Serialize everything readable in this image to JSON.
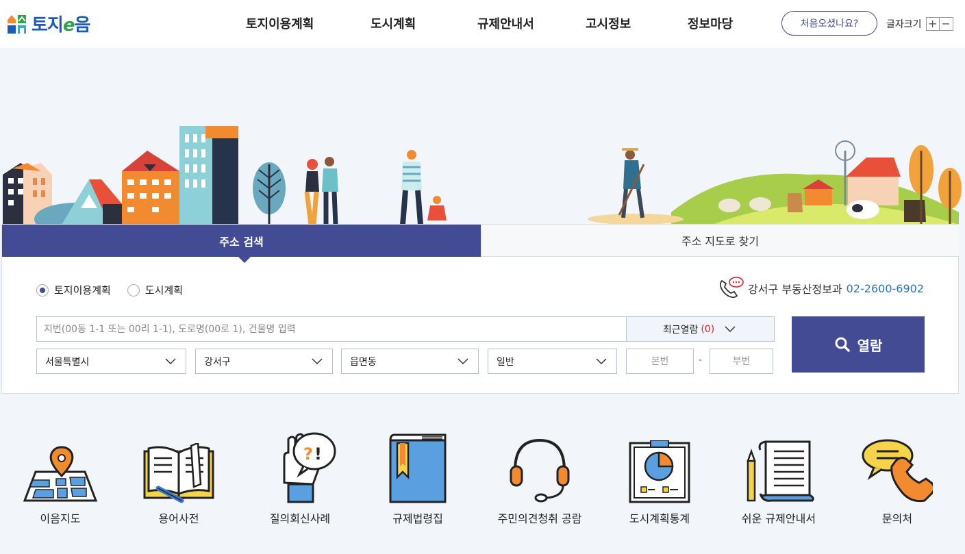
{
  "logo": {
    "text": "토지",
    "e": "e",
    "suffix": "음"
  },
  "gnb": [
    "토지이용계획",
    "도시계획",
    "규제안내서",
    "고시정보",
    "정보마당"
  ],
  "first_visit_label": "처음오셨나요?",
  "font_size": {
    "label": "글자크기",
    "plus": "+",
    "minus": "−"
  },
  "tabs": {
    "active": "주소 검색",
    "inactive": "주소 지도로 찾기"
  },
  "radios": {
    "option1": "토지이용계획",
    "option2": "도시계획",
    "selected": "토지이용계획"
  },
  "contact": {
    "office": "강서구 부동산정보과",
    "phone": "02-2600-6902"
  },
  "search": {
    "placeholder": "지번(00동 1-1 또는 00리 1-1), 도로명(00로 1), 건물명 입력",
    "recent_label": "최근열람",
    "recent_count": "(0)",
    "view_label": "열람"
  },
  "selects": {
    "sido": "서울특별시",
    "sigungu": "강서구",
    "dong": "읍면동",
    "type": "일반"
  },
  "lot": {
    "main_placeholder": "본번",
    "sub_placeholder": "부번",
    "separator": "-"
  },
  "quick_menu": [
    {
      "label": "이음지도",
      "icon": "map-pin-icon"
    },
    {
      "label": "용어사전",
      "icon": "dictionary-book-icon"
    },
    {
      "label": "질의회신사례",
      "icon": "question-hand-icon"
    },
    {
      "label": "규제법령집",
      "icon": "law-book-icon"
    },
    {
      "label": "주민의견청취 공람",
      "icon": "headset-icon"
    },
    {
      "label": "도시계획통계",
      "icon": "pie-chart-board-icon"
    },
    {
      "label": "쉬운 규제안내서",
      "icon": "document-scroll-icon"
    },
    {
      "label": "문의처",
      "icon": "phone-speech-icon"
    }
  ],
  "colors": {
    "primary": "#434b94",
    "accent_orange": "#f28b30",
    "link_blue": "#2a73c5",
    "alert_red": "#d3252b"
  }
}
